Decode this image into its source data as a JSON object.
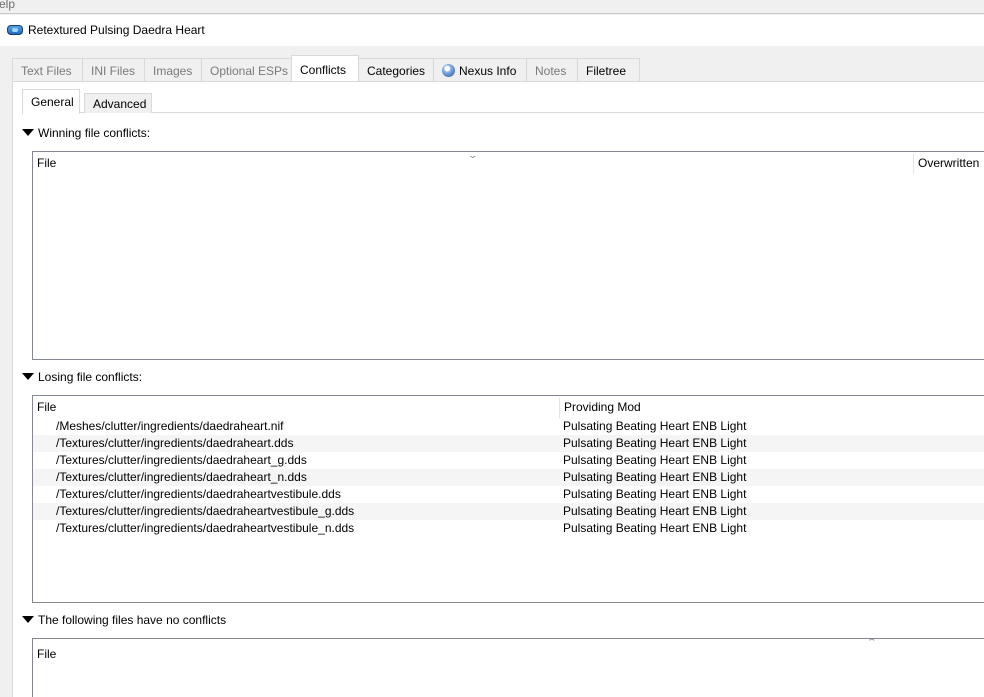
{
  "menubar": {
    "label": "elp"
  },
  "window": {
    "title": "Retextured Pulsing Daedra Heart"
  },
  "tabs": [
    {
      "label": "Text Files",
      "state": "disabled"
    },
    {
      "label": "INI Files",
      "state": "disabled"
    },
    {
      "label": "Images",
      "state": "disabled"
    },
    {
      "label": "Optional ESPs",
      "state": "disabled"
    },
    {
      "label": "Conflicts",
      "state": "active"
    },
    {
      "label": "Categories",
      "state": "enabled"
    },
    {
      "label": "Nexus Info",
      "state": "enabled",
      "icon": "globe-icon"
    },
    {
      "label": "Notes",
      "state": "disabled"
    },
    {
      "label": "Filetree",
      "state": "enabled"
    }
  ],
  "subtabs": [
    {
      "label": "General",
      "state": "active"
    },
    {
      "label": "Advanced",
      "state": "enabled"
    }
  ],
  "winning": {
    "header": "Winning file conflicts:",
    "columns": [
      "File",
      "Overwritten"
    ],
    "rows": []
  },
  "losing": {
    "header": "Losing file conflicts:",
    "columns": [
      "File",
      "Providing Mod"
    ],
    "rows": [
      {
        "file": "/Meshes/clutter/ingredients/daedraheart.nif",
        "mod": "Pulsating Beating Heart ENB Light"
      },
      {
        "file": "/Textures/clutter/ingredients/daedraheart.dds",
        "mod": "Pulsating Beating Heart ENB Light"
      },
      {
        "file": "/Textures/clutter/ingredients/daedraheart_g.dds",
        "mod": "Pulsating Beating Heart ENB Light"
      },
      {
        "file": "/Textures/clutter/ingredients/daedraheart_n.dds",
        "mod": "Pulsating Beating Heart ENB Light"
      },
      {
        "file": "/Textures/clutter/ingredients/daedraheartvestibule.dds",
        "mod": "Pulsating Beating Heart ENB Light"
      },
      {
        "file": "/Textures/clutter/ingredients/daedraheartvestibule_g.dds",
        "mod": "Pulsating Beating Heart ENB Light"
      },
      {
        "file": "/Textures/clutter/ingredients/daedraheartvestibule_n.dds",
        "mod": "Pulsating Beating Heart ENB Light"
      }
    ]
  },
  "noconflict": {
    "header": "The following files have no conflicts",
    "columns": [
      "File"
    ]
  },
  "icons": {
    "window": "mod-organizer-icon",
    "nexus_tab": "globe-icon",
    "section_toggle": "collapse-triangle-icon",
    "sort_desc": "sort-descending-icon",
    "sort_asc": "sort-ascending-icon"
  }
}
